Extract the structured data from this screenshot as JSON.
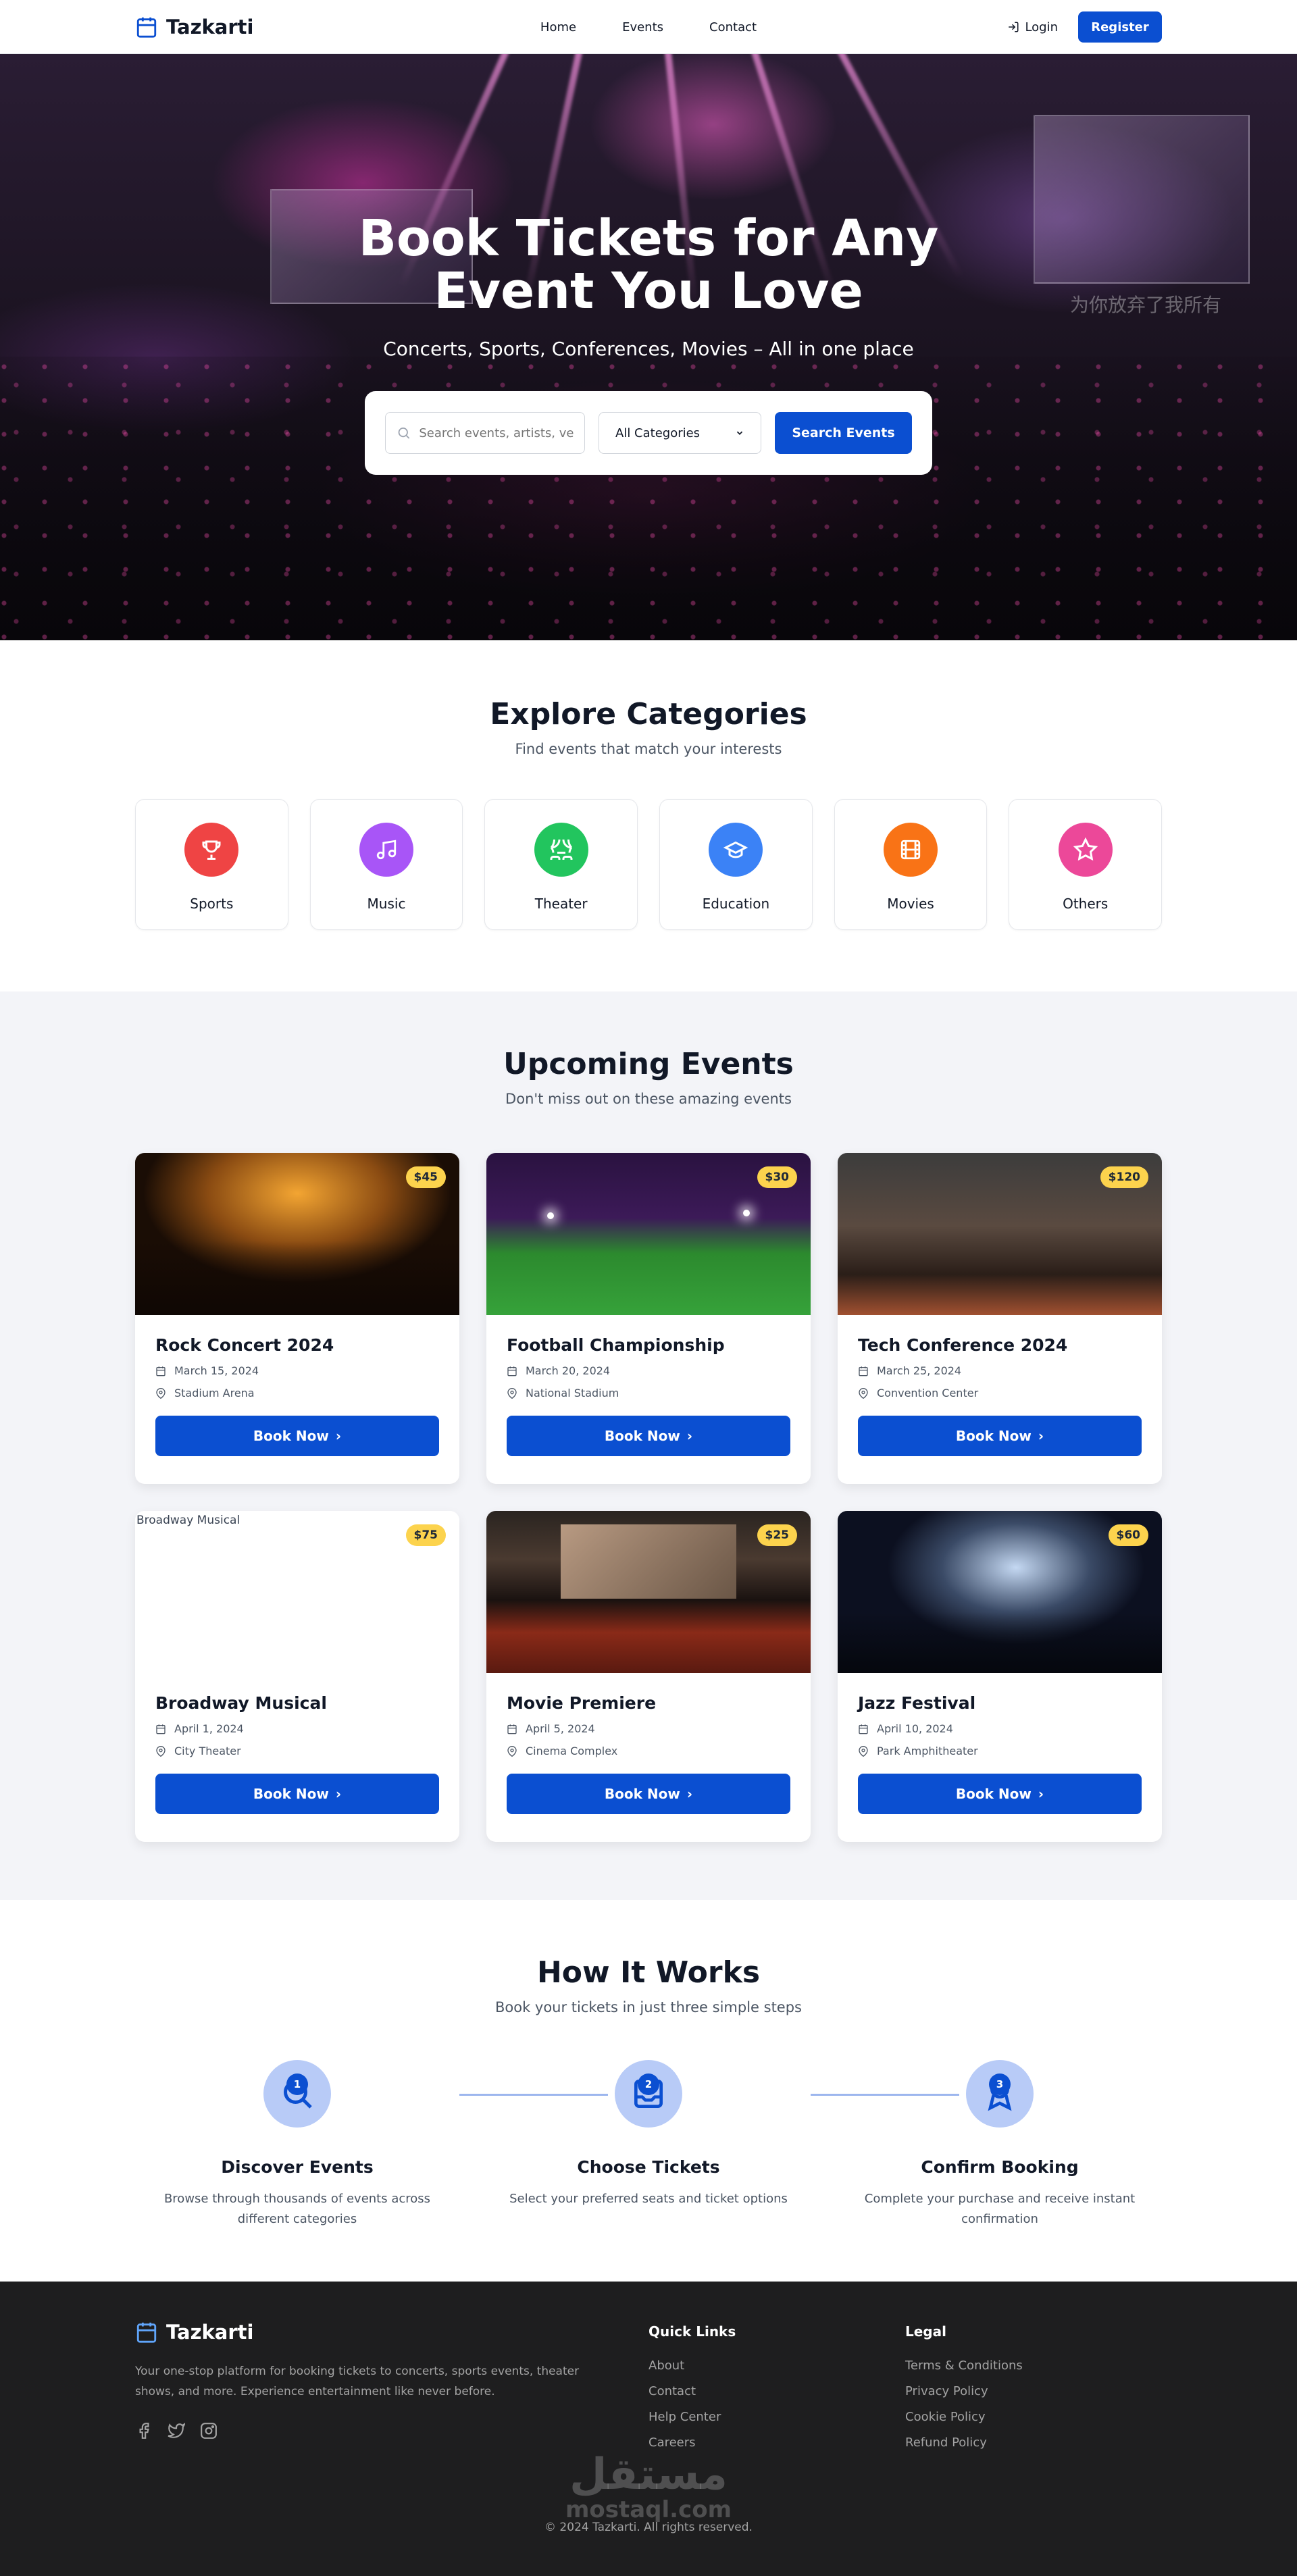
{
  "nav": {
    "brand": "Tazkarti",
    "links": [
      "Home",
      "Events",
      "Contact"
    ],
    "login": "Login",
    "register": "Register"
  },
  "hero": {
    "title": "Book Tickets for Any Event You Love",
    "subtitle": "Concerts, Sports, Conferences, Movies – All in one place",
    "search_placeholder": "Search events, artists, venues...",
    "category_select": "All Categories",
    "search_button": "Search Events",
    "watermark_text": "为你放弃了我所有"
  },
  "categories": {
    "title": "Explore Categories",
    "subtitle": "Find events that match your interests",
    "items": [
      {
        "label": "Sports",
        "icon": "trophy-icon",
        "color": "#ef4444"
      },
      {
        "label": "Music",
        "icon": "music-note-icon",
        "color": "#a855f7"
      },
      {
        "label": "Theater",
        "icon": "theater-icon",
        "color": "#22c55e"
      },
      {
        "label": "Education",
        "icon": "graduation-cap-icon",
        "color": "#3b82f6"
      },
      {
        "label": "Movies",
        "icon": "film-icon",
        "color": "#f97316"
      },
      {
        "label": "Others",
        "icon": "star-icon",
        "color": "#ec4899"
      }
    ]
  },
  "events": {
    "title": "Upcoming Events",
    "subtitle": "Don't miss out on these amazing events",
    "book_label": "Book Now",
    "items": [
      {
        "title": "Rock Concert 2024",
        "date": "March 15, 2024",
        "venue": "Stadium Arena",
        "price": "$45"
      },
      {
        "title": "Football Championship",
        "date": "March 20, 2024",
        "venue": "National Stadium",
        "price": "$30"
      },
      {
        "title": "Tech Conference 2024",
        "date": "March 25, 2024",
        "venue": "Convention Center",
        "price": "$120"
      },
      {
        "title": "Broadway Musical",
        "date": "April 1, 2024",
        "venue": "City Theater",
        "price": "$75",
        "image_alt": "Broadway Musical"
      },
      {
        "title": "Movie Premiere",
        "date": "April 5, 2024",
        "venue": "Cinema Complex",
        "price": "$25"
      },
      {
        "title": "Jazz Festival",
        "date": "April 10, 2024",
        "venue": "Park Amphitheater",
        "price": "$60"
      }
    ]
  },
  "how": {
    "title": "How It Works",
    "subtitle": "Book your tickets in just three simple steps",
    "steps": [
      {
        "num": "1",
        "title": "Discover Events",
        "desc": "Browse through thousands of events across different categories"
      },
      {
        "num": "2",
        "title": "Choose Tickets",
        "desc": "Select your preferred seats and ticket options"
      },
      {
        "num": "3",
        "title": "Confirm Booking",
        "desc": "Complete your purchase and receive instant confirmation"
      }
    ]
  },
  "footer": {
    "brand": "Tazkarti",
    "desc": "Your one-stop platform for booking tickets to concerts, sports events, theater shows, and more. Experience entertainment like never before.",
    "quick_links_title": "Quick Links",
    "quick_links": [
      "About",
      "Contact",
      "Help Center",
      "Careers"
    ],
    "legal_title": "Legal",
    "legal": [
      "Terms & Conditions",
      "Privacy Policy",
      "Cookie Policy",
      "Refund Policy"
    ],
    "copyright": "© 2024 Tazkarti. All rights reserved.",
    "watermark_ar": "مستقل",
    "watermark_en": "mostaql.com"
  }
}
